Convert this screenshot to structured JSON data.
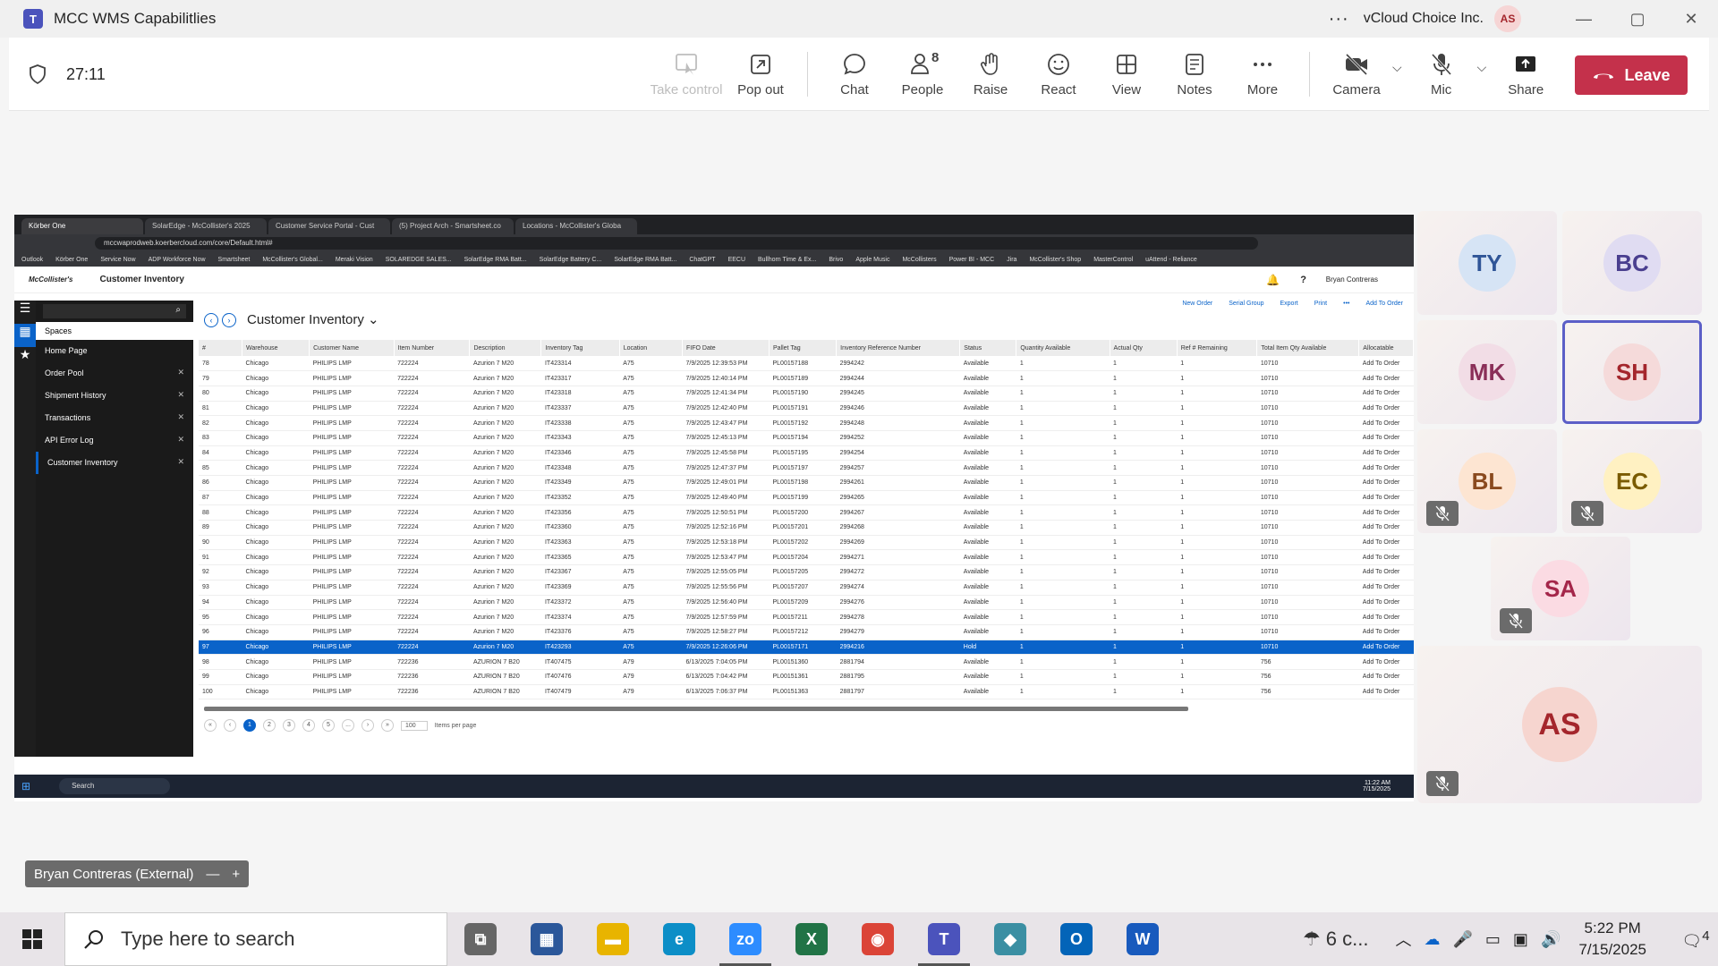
{
  "window": {
    "title": "MCC WMS Capabilitlies",
    "org": "vCloud Choice Inc.",
    "user_initials": "AS",
    "min": "—",
    "max": "▢",
    "close": "✕"
  },
  "meeting": {
    "timer": "27:11",
    "tools": [
      {
        "label": "Take control",
        "icon": "take-control-icon",
        "disabled": true
      },
      {
        "label": "Pop out",
        "icon": "pop-out-icon"
      },
      {
        "label": "Chat",
        "icon": "chat-icon"
      },
      {
        "label": "People",
        "icon": "people-icon",
        "count": "8"
      },
      {
        "label": "Raise",
        "icon": "raise-hand-icon"
      },
      {
        "label": "React",
        "icon": "react-icon"
      },
      {
        "label": "View",
        "icon": "view-icon"
      },
      {
        "label": "Notes",
        "icon": "notes-icon"
      },
      {
        "label": "More",
        "icon": "more-icon"
      },
      {
        "label": "Camera",
        "icon": "camera-off-icon"
      },
      {
        "label": "Mic",
        "icon": "mic-off-icon"
      },
      {
        "label": "Share",
        "icon": "share-icon"
      }
    ],
    "leave": "Leave",
    "presenter_tag": "Bryan Contreras (External)"
  },
  "participants": [
    {
      "initials": "TY",
      "color": "#d6e4f5",
      "fg": "#2f5597",
      "muted": false
    },
    {
      "initials": "BC",
      "color": "#e0dcf2",
      "fg": "#4a3f8f",
      "muted": false
    },
    {
      "initials": "MK",
      "color": "#f2dde6",
      "fg": "#8a2f58",
      "muted": false
    },
    {
      "initials": "SH",
      "color": "#f5dada",
      "fg": "#a4262c",
      "muted": false,
      "speaking": true
    },
    {
      "initials": "BL",
      "color": "#fde5d2",
      "fg": "#8a4a1f",
      "muted": true
    },
    {
      "initials": "EC",
      "color": "#fff1c2",
      "fg": "#7a5b00",
      "muted": true
    },
    {
      "initials": "SA",
      "color": "#fbdbe3",
      "fg": "#a4264a",
      "muted": true
    },
    {
      "initials": "AS",
      "color": "#f6d5cf",
      "fg": "#a4262c",
      "muted": true
    }
  ],
  "browser": {
    "tabs": [
      "Körber One",
      "SolarEdge - McCollister's 2025",
      "Customer Service Portal - Cust",
      "(5) Project Arch - Smartsheet.co",
      "Locations - McCollister's Globa"
    ],
    "url": "mccwaprodweb.koerbercloud.com/core/Default.html#",
    "bookmarks": [
      "Outlook",
      "Körber One",
      "Service Now",
      "ADP Workforce Now",
      "Smartsheet",
      "McCollister's Global...",
      "Meraki Vision",
      "SOLAREDGE SALES...",
      "SolarEdge RMA Batt...",
      "SolarEdge Battery C...",
      "SolarEdge RMA Batt...",
      "ChatGPT",
      "EECU",
      "Bullhorn Time & Ex...",
      "Brivo",
      "Apple Music",
      "McCollisters",
      "Power BI - MCC",
      "Jira",
      "McCollister's Shop",
      "MasterControl",
      "uAttend - Reliance"
    ]
  },
  "wms": {
    "logo": "McCollister's",
    "page_name": "Customer Inventory",
    "user": "Bryan Contreras",
    "spaces": "Spaces",
    "nav": [
      "Home Page",
      "Order Pool",
      "Shipment History",
      "Transactions",
      "API Error Log",
      "Customer Inventory"
    ],
    "title": "Customer Inventory",
    "actions": [
      "New Order",
      "Serial Group",
      "Export",
      "Print",
      "•••",
      "Add To Order"
    ],
    "columns": [
      "#",
      "Warehouse",
      "Customer Name",
      "Item Number",
      "Description",
      "Inventory Tag",
      "Location",
      "FIFO Date",
      "Pallet Tag",
      "Inventory Reference Number",
      "Status",
      "Quantity Available",
      "Actual Qty",
      "Ref # Remaining",
      "Total Item Qty Available",
      "Allocatable"
    ],
    "rows": [
      [
        "78",
        "Chicago",
        "PHILIPS LMP",
        "722224",
        "Azurion 7 M20",
        "IT423314",
        "A75",
        "7/9/2025 12:39:53 PM",
        "PL00157188",
        "2994242",
        "Available",
        "1",
        "1",
        "1",
        "10710",
        "Add To Order"
      ],
      [
        "79",
        "Chicago",
        "PHILIPS LMP",
        "722224",
        "Azurion 7 M20",
        "IT423317",
        "A75",
        "7/9/2025 12:40:14 PM",
        "PL00157189",
        "2994244",
        "Available",
        "1",
        "1",
        "1",
        "10710",
        "Add To Order"
      ],
      [
        "80",
        "Chicago",
        "PHILIPS LMP",
        "722224",
        "Azurion 7 M20",
        "IT423318",
        "A75",
        "7/9/2025 12:41:34 PM",
        "PL00157190",
        "2994245",
        "Available",
        "1",
        "1",
        "1",
        "10710",
        "Add To Order"
      ],
      [
        "81",
        "Chicago",
        "PHILIPS LMP",
        "722224",
        "Azurion 7 M20",
        "IT423337",
        "A75",
        "7/9/2025 12:42:40 PM",
        "PL00157191",
        "2994246",
        "Available",
        "1",
        "1",
        "1",
        "10710",
        "Add To Order"
      ],
      [
        "82",
        "Chicago",
        "PHILIPS LMP",
        "722224",
        "Azurion 7 M20",
        "IT423338",
        "A75",
        "7/9/2025 12:43:47 PM",
        "PL00157192",
        "2994248",
        "Available",
        "1",
        "1",
        "1",
        "10710",
        "Add To Order"
      ],
      [
        "83",
        "Chicago",
        "PHILIPS LMP",
        "722224",
        "Azurion 7 M20",
        "IT423343",
        "A75",
        "7/9/2025 12:45:13 PM",
        "PL00157194",
        "2994252",
        "Available",
        "1",
        "1",
        "1",
        "10710",
        "Add To Order"
      ],
      [
        "84",
        "Chicago",
        "PHILIPS LMP",
        "722224",
        "Azurion 7 M20",
        "IT423346",
        "A75",
        "7/9/2025 12:45:58 PM",
        "PL00157195",
        "2994254",
        "Available",
        "1",
        "1",
        "1",
        "10710",
        "Add To Order"
      ],
      [
        "85",
        "Chicago",
        "PHILIPS LMP",
        "722224",
        "Azurion 7 M20",
        "IT423348",
        "A75",
        "7/9/2025 12:47:37 PM",
        "PL00157197",
        "2994257",
        "Available",
        "1",
        "1",
        "1",
        "10710",
        "Add To Order"
      ],
      [
        "86",
        "Chicago",
        "PHILIPS LMP",
        "722224",
        "Azurion 7 M20",
        "IT423349",
        "A75",
        "7/9/2025 12:49:01 PM",
        "PL00157198",
        "2994261",
        "Available",
        "1",
        "1",
        "1",
        "10710",
        "Add To Order"
      ],
      [
        "87",
        "Chicago",
        "PHILIPS LMP",
        "722224",
        "Azurion 7 M20",
        "IT423352",
        "A75",
        "7/9/2025 12:49:40 PM",
        "PL00157199",
        "2994265",
        "Available",
        "1",
        "1",
        "1",
        "10710",
        "Add To Order"
      ],
      [
        "88",
        "Chicago",
        "PHILIPS LMP",
        "722224",
        "Azurion 7 M20",
        "IT423356",
        "A75",
        "7/9/2025 12:50:51 PM",
        "PL00157200",
        "2994267",
        "Available",
        "1",
        "1",
        "1",
        "10710",
        "Add To Order"
      ],
      [
        "89",
        "Chicago",
        "PHILIPS LMP",
        "722224",
        "Azurion 7 M20",
        "IT423360",
        "A75",
        "7/9/2025 12:52:16 PM",
        "PL00157201",
        "2994268",
        "Available",
        "1",
        "1",
        "1",
        "10710",
        "Add To Order"
      ],
      [
        "90",
        "Chicago",
        "PHILIPS LMP",
        "722224",
        "Azurion 7 M20",
        "IT423363",
        "A75",
        "7/9/2025 12:53:18 PM",
        "PL00157202",
        "2994269",
        "Available",
        "1",
        "1",
        "1",
        "10710",
        "Add To Order"
      ],
      [
        "91",
        "Chicago",
        "PHILIPS LMP",
        "722224",
        "Azurion 7 M20",
        "IT423365",
        "A75",
        "7/9/2025 12:53:47 PM",
        "PL00157204",
        "2994271",
        "Available",
        "1",
        "1",
        "1",
        "10710",
        "Add To Order"
      ],
      [
        "92",
        "Chicago",
        "PHILIPS LMP",
        "722224",
        "Azurion 7 M20",
        "IT423367",
        "A75",
        "7/9/2025 12:55:05 PM",
        "PL00157205",
        "2994272",
        "Available",
        "1",
        "1",
        "1",
        "10710",
        "Add To Order"
      ],
      [
        "93",
        "Chicago",
        "PHILIPS LMP",
        "722224",
        "Azurion 7 M20",
        "IT423369",
        "A75",
        "7/9/2025 12:55:56 PM",
        "PL00157207",
        "2994274",
        "Available",
        "1",
        "1",
        "1",
        "10710",
        "Add To Order"
      ],
      [
        "94",
        "Chicago",
        "PHILIPS LMP",
        "722224",
        "Azurion 7 M20",
        "IT423372",
        "A75",
        "7/9/2025 12:56:40 PM",
        "PL00157209",
        "2994276",
        "Available",
        "1",
        "1",
        "1",
        "10710",
        "Add To Order"
      ],
      [
        "95",
        "Chicago",
        "PHILIPS LMP",
        "722224",
        "Azurion 7 M20",
        "IT423374",
        "A75",
        "7/9/2025 12:57:59 PM",
        "PL00157211",
        "2994278",
        "Available",
        "1",
        "1",
        "1",
        "10710",
        "Add To Order"
      ],
      [
        "96",
        "Chicago",
        "PHILIPS LMP",
        "722224",
        "Azurion 7 M20",
        "IT423376",
        "A75",
        "7/9/2025 12:58:27 PM",
        "PL00157212",
        "2994279",
        "Available",
        "1",
        "1",
        "1",
        "10710",
        "Add To Order"
      ],
      [
        "97",
        "Chicago",
        "PHILIPS LMP",
        "722224",
        "Azurion 7 M20",
        "IT423293",
        "A75",
        "7/9/2025 12:26:06 PM",
        "PL00157171",
        "2994216",
        "Hold",
        "1",
        "1",
        "1",
        "10710",
        "Add To Order"
      ],
      [
        "98",
        "Chicago",
        "PHILIPS LMP",
        "722236",
        "AZURION 7 B20",
        "IT407475",
        "A79",
        "6/13/2025 7:04:05 PM",
        "PL00151360",
        "2881794",
        "Available",
        "1",
        "1",
        "1",
        "756",
        "Add To Order"
      ],
      [
        "99",
        "Chicago",
        "PHILIPS LMP",
        "722236",
        "AZURION 7 B20",
        "IT407476",
        "A79",
        "6/13/2025 7:04:42 PM",
        "PL00151361",
        "2881795",
        "Available",
        "1",
        "1",
        "1",
        "756",
        "Add To Order"
      ],
      [
        "100",
        "Chicago",
        "PHILIPS LMP",
        "722236",
        "AZURION 7 B20",
        "IT407479",
        "A79",
        "6/13/2025 7:06:37 PM",
        "PL00151363",
        "2881797",
        "Available",
        "1",
        "1",
        "1",
        "756",
        "Add To Order"
      ]
    ],
    "selected_row_index": 19,
    "pager": {
      "pages": [
        "1",
        "2",
        "3",
        "4",
        "5",
        "..."
      ],
      "per_page": "100",
      "per_page_label": "Items per page"
    },
    "inner_taskbar": {
      "search": "Search",
      "time": "11:22 AM",
      "date": "7/15/2025"
    }
  },
  "taskbar": {
    "search_placeholder": "Type here to search",
    "weather": "6 c...",
    "time": "5:22 PM",
    "date": "7/15/2025",
    "notifications": "4",
    "apps": [
      {
        "name": "task-view",
        "color": "#666",
        "glyph": "⧉"
      },
      {
        "name": "calculator",
        "color": "#2b579a",
        "glyph": "▦"
      },
      {
        "name": "file-explorer",
        "color": "#e8b400",
        "glyph": "▬"
      },
      {
        "name": "edge",
        "color": "#0c8ec7",
        "glyph": "e"
      },
      {
        "name": "zoom",
        "color": "#2d8cff",
        "glyph": "zo",
        "active": true
      },
      {
        "name": "excel",
        "color": "#217346",
        "glyph": "X"
      },
      {
        "name": "chrome",
        "color": "#db4437",
        "glyph": "◉"
      },
      {
        "name": "teams",
        "color": "#4b53bc",
        "glyph": "T",
        "active": true
      },
      {
        "name": "diamond-app",
        "color": "#3b8fa3",
        "glyph": "◆"
      },
      {
        "name": "outlook",
        "color": "#0364b8",
        "glyph": "O"
      },
      {
        "name": "word",
        "color": "#185abd",
        "glyph": "W"
      }
    ]
  },
  "colors": {
    "accent": "#5b5fc7",
    "leave": "#c4314b",
    "selection": "#0a63c9"
  }
}
